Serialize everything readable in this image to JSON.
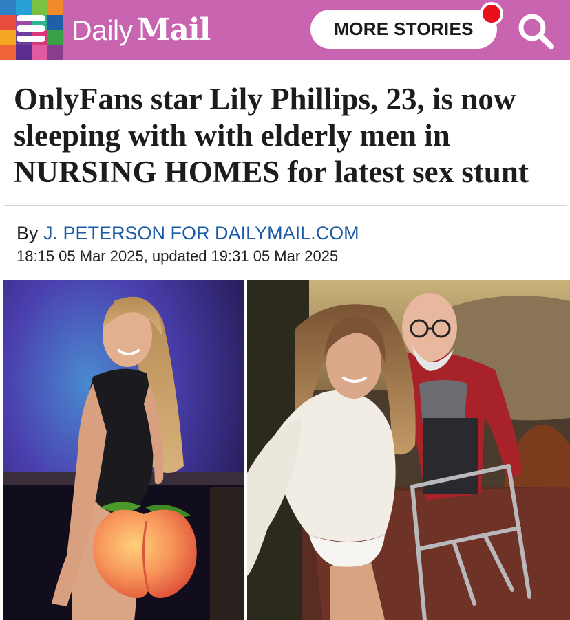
{
  "header": {
    "brand_daily": "Daily",
    "brand_mail": "Mail",
    "more_stories_label": "MORE STORIES",
    "colors": {
      "bar": "#c864b0",
      "notification": "#e8101a"
    }
  },
  "article": {
    "headline_line1": "OnlyFans star Lily Phillips, 23, is now",
    "headline_line2": "sleeping with with elderly men in",
    "headline_line3": "NURSING HOMES for latest sex stunt",
    "byline_prefix": "By",
    "author": "J. PETERSON FOR DAILYMAIL.COM",
    "dateline": "18:15 05 Mar 2025, updated 19:31 05 Mar 2025"
  },
  "images": {
    "left_icon": "peach-emoji-icon",
    "right_icon": "walking-frame"
  }
}
